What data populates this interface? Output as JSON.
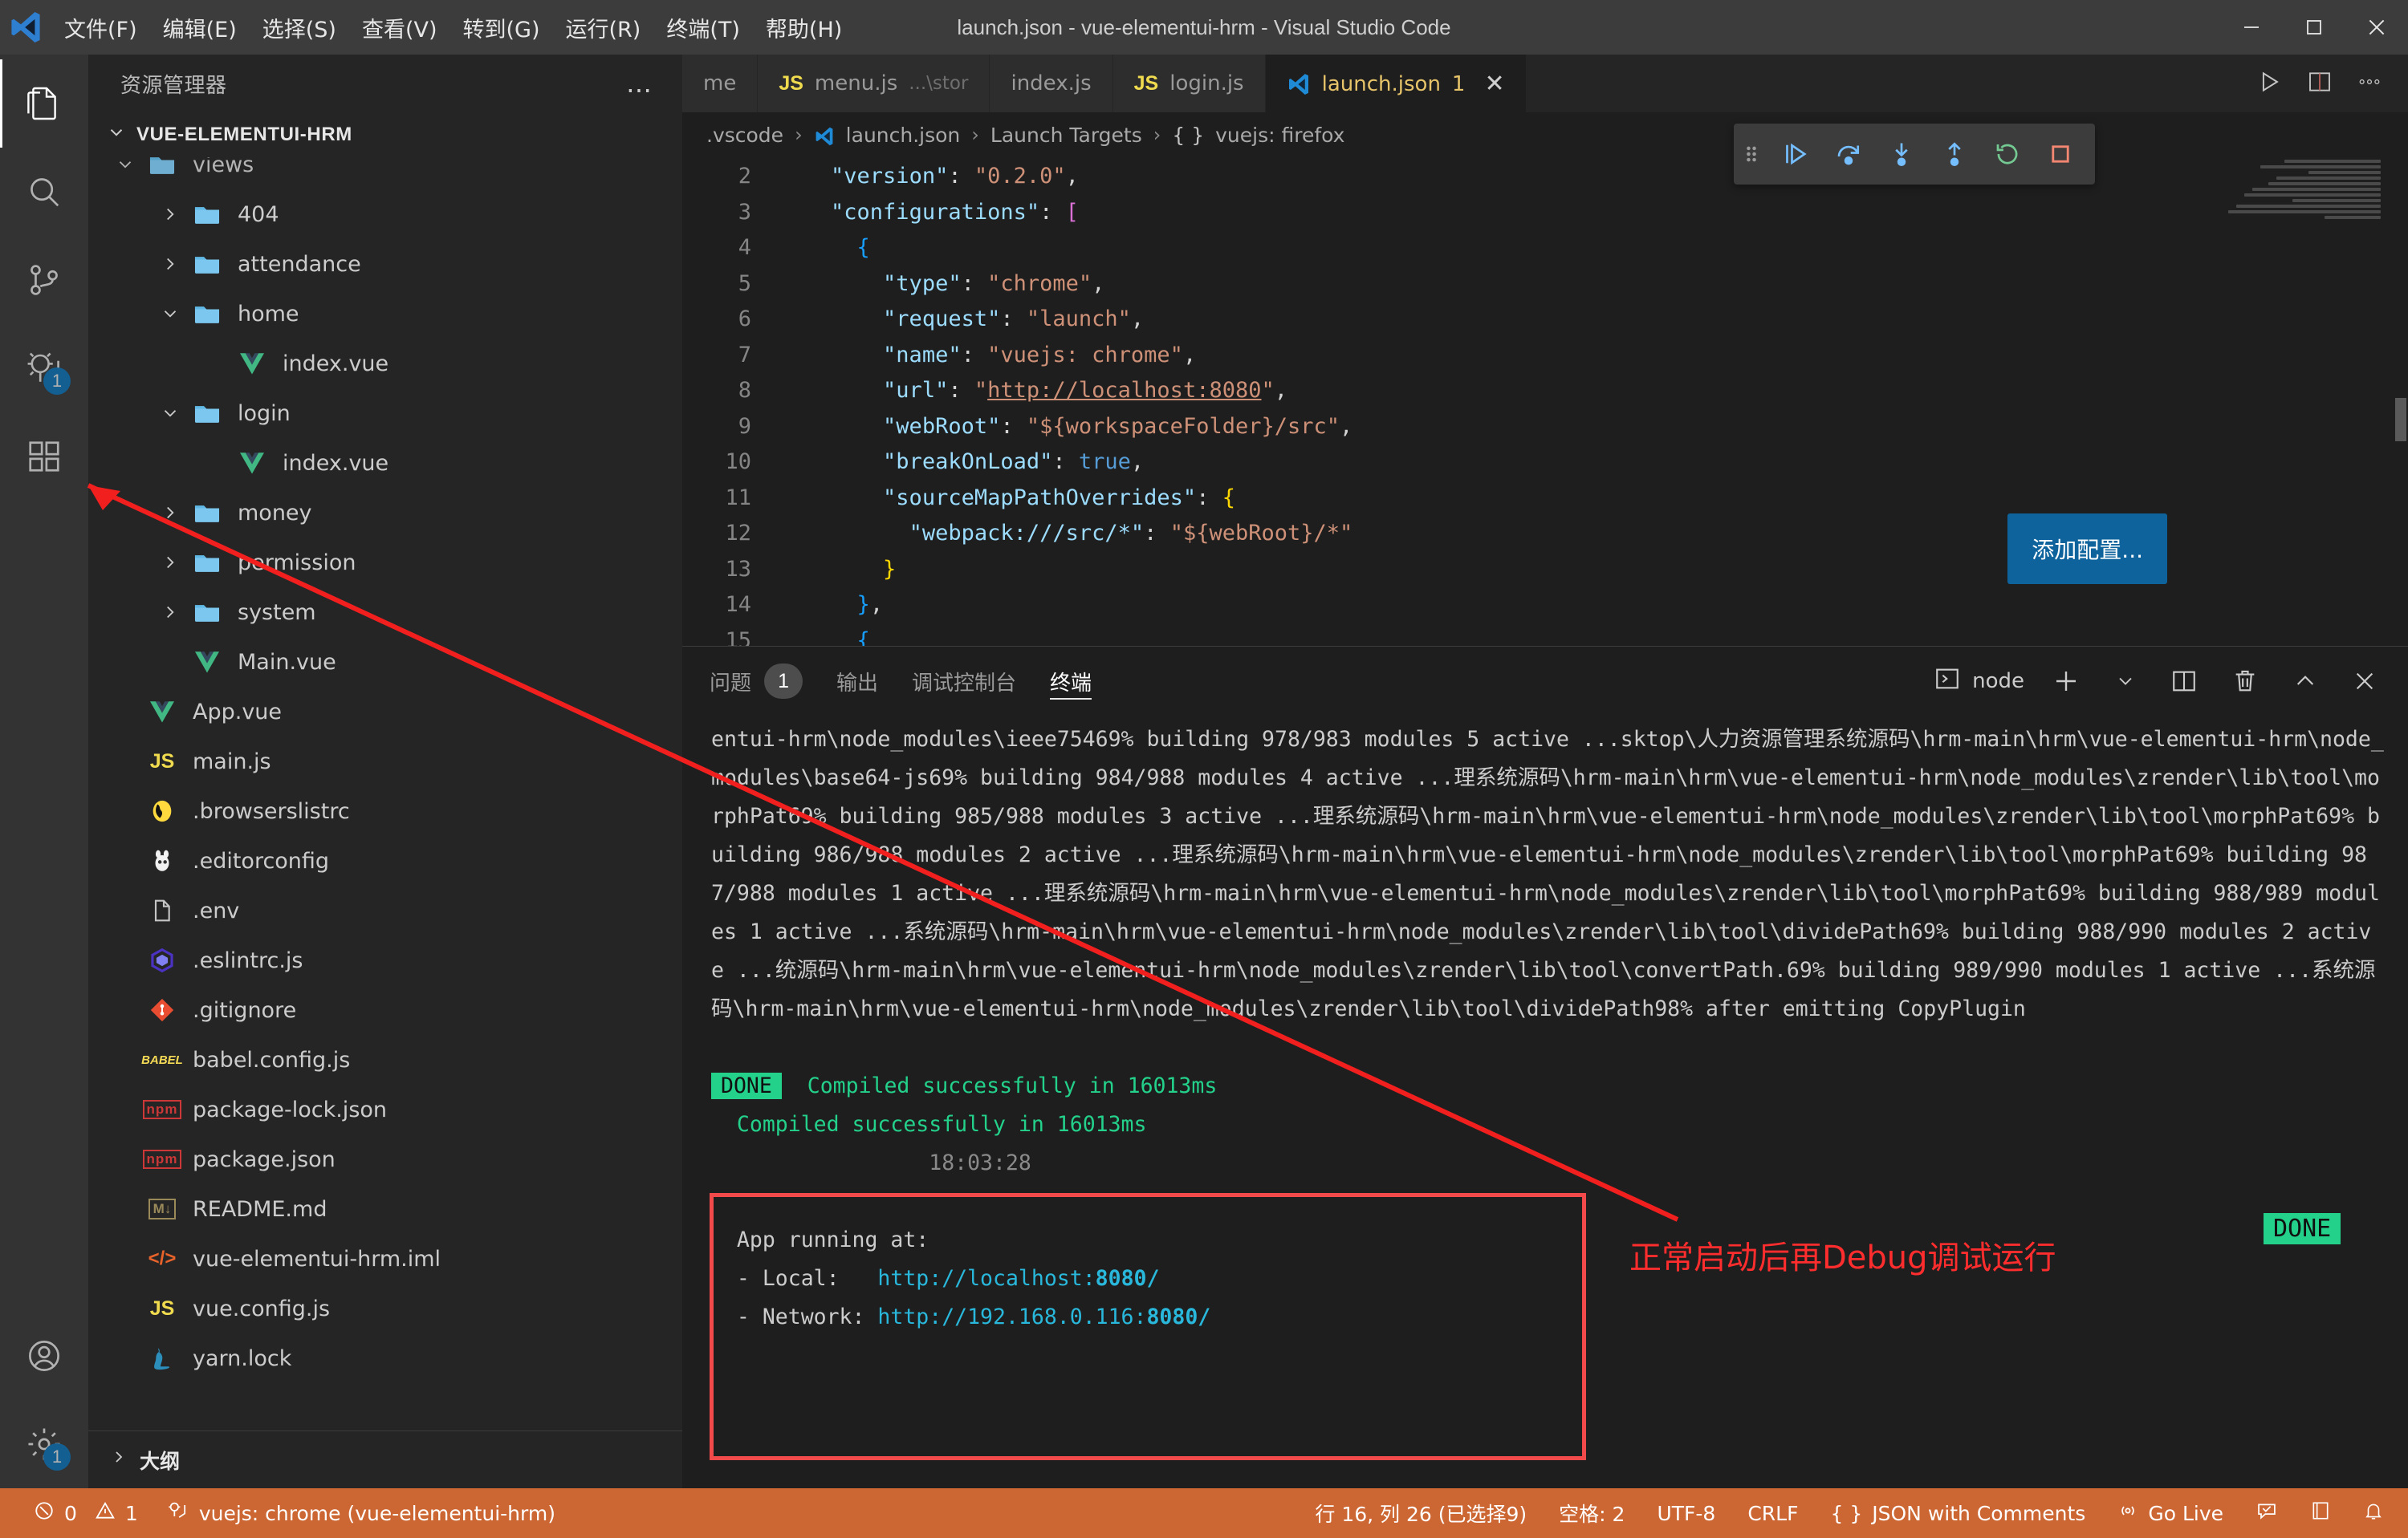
{
  "window": {
    "title": "launch.json - vue-elementui-hrm - Visual Studio Code",
    "menu": [
      "文件(F)",
      "编辑(E)",
      "选择(S)",
      "查看(V)",
      "转到(G)",
      "运行(R)",
      "终端(T)",
      "帮助(H)"
    ],
    "controls": {
      "minimize": "minimize-icon",
      "maximize": "maximize-icon",
      "close": "close-icon"
    }
  },
  "activitybar": {
    "items": [
      {
        "name": "explorer",
        "icon": "files-icon",
        "badge": ""
      },
      {
        "name": "search",
        "icon": "search-icon",
        "badge": ""
      },
      {
        "name": "source-control",
        "icon": "source-control-icon",
        "badge": ""
      },
      {
        "name": "run-and-debug",
        "icon": "debug-icon",
        "badge": "1"
      },
      {
        "name": "extensions",
        "icon": "extensions-icon",
        "badge": ""
      }
    ],
    "bottom": [
      {
        "name": "accounts",
        "icon": "account-icon",
        "badge": ""
      },
      {
        "name": "settings",
        "icon": "gear-icon",
        "badge": "1"
      }
    ]
  },
  "sidebar": {
    "header": "资源管理器",
    "more_actions": "…",
    "root": "VUE-ELEMENTUI-HRM",
    "outline": "大纲",
    "tree": [
      {
        "label": "views",
        "indent": 1,
        "icon": "folder-icon",
        "state": "expanded",
        "cut": true
      },
      {
        "label": "404",
        "indent": 2,
        "icon": "folder-icon",
        "state": "collapsed"
      },
      {
        "label": "attendance",
        "indent": 2,
        "icon": "folder-icon",
        "state": "collapsed"
      },
      {
        "label": "home",
        "indent": 2,
        "icon": "folder-icon",
        "state": "expanded"
      },
      {
        "label": "index.vue",
        "indent": 3,
        "icon": "vue-icon",
        "state": "leaf"
      },
      {
        "label": "login",
        "indent": 2,
        "icon": "folder-icon",
        "state": "expanded"
      },
      {
        "label": "index.vue",
        "indent": 3,
        "icon": "vue-icon",
        "state": "leaf"
      },
      {
        "label": "money",
        "indent": 2,
        "icon": "folder-icon",
        "state": "collapsed"
      },
      {
        "label": "permission",
        "indent": 2,
        "icon": "folder-icon",
        "state": "collapsed"
      },
      {
        "label": "system",
        "indent": 2,
        "icon": "folder-icon",
        "state": "collapsed"
      },
      {
        "label": "Main.vue",
        "indent": 2,
        "icon": "vue-icon",
        "state": "leaf"
      },
      {
        "label": "App.vue",
        "indent": 1,
        "icon": "vue-icon",
        "state": "leaf"
      },
      {
        "label": "main.js",
        "indent": 1,
        "icon": "js-icon",
        "state": "leaf"
      },
      {
        "label": ".browserslistrc",
        "indent": 1,
        "icon": "browserslist-icon",
        "state": "leaf"
      },
      {
        "label": ".editorconfig",
        "indent": 1,
        "icon": "editorconfig-icon",
        "state": "leaf"
      },
      {
        "label": ".env",
        "indent": 1,
        "icon": "file-icon",
        "state": "leaf"
      },
      {
        "label": ".eslintrc.js",
        "indent": 1,
        "icon": "eslint-icon",
        "state": "leaf"
      },
      {
        "label": ".gitignore",
        "indent": 1,
        "icon": "git-icon",
        "state": "leaf"
      },
      {
        "label": "babel.config.js",
        "indent": 1,
        "icon": "babel-icon",
        "state": "leaf"
      },
      {
        "label": "package-lock.json",
        "indent": 1,
        "icon": "npm-icon",
        "state": "leaf"
      },
      {
        "label": "package.json",
        "indent": 1,
        "icon": "npm-icon",
        "state": "leaf"
      },
      {
        "label": "README.md",
        "indent": 1,
        "icon": "markdown-icon",
        "state": "leaf"
      },
      {
        "label": "vue-elementui-hrm.iml",
        "indent": 1,
        "icon": "xml-icon",
        "state": "leaf"
      },
      {
        "label": "vue.config.js",
        "indent": 1,
        "icon": "js-icon",
        "state": "leaf"
      },
      {
        "label": "yarn.lock",
        "indent": 1,
        "icon": "yarn-icon",
        "state": "leaf"
      }
    ]
  },
  "editor": {
    "tabs": [
      {
        "label": "me",
        "detail": "",
        "icon": "",
        "active": false,
        "dirty": ""
      },
      {
        "label": "menu.js",
        "detail": "...\\stor",
        "icon": "js-icon",
        "active": false,
        "dirty": ""
      },
      {
        "label": "index.js",
        "detail": "",
        "icon": "",
        "active": false,
        "dirty": ""
      },
      {
        "label": "login.js",
        "detail": "",
        "icon": "js-icon",
        "active": false,
        "dirty": ""
      },
      {
        "label": "launch.json",
        "detail": "1",
        "icon": "vscode-icon",
        "active": true,
        "dirty": ""
      }
    ],
    "tab_close": "✕",
    "actions": [
      "run-icon",
      "split-editor-icon",
      "more-actions-icon"
    ],
    "breadcrumb": [
      ".vscode",
      "launch.json",
      "Launch Targets",
      "vuejs: firefox"
    ],
    "breadcrumb_icons": [
      "",
      "vscode-icon",
      "",
      "braces-icon"
    ],
    "add_config_button": "添加配置...",
    "lines": [
      {
        "n": "2",
        "tokens": [
          {
            "t": "    ",
            "c": "k-punc"
          },
          {
            "t": "\"version\"",
            "c": "k-key"
          },
          {
            "t": ": ",
            "c": "k-punc"
          },
          {
            "t": "\"0.2.0\"",
            "c": "k-str"
          },
          {
            "t": ",",
            "c": "k-punc"
          }
        ]
      },
      {
        "n": "3",
        "tokens": [
          {
            "t": "    ",
            "c": "k-punc"
          },
          {
            "t": "\"configurations\"",
            "c": "k-key"
          },
          {
            "t": ": ",
            "c": "k-punc"
          },
          {
            "t": "[",
            "c": "k-brk1"
          }
        ]
      },
      {
        "n": "4",
        "tokens": [
          {
            "t": "      ",
            "c": "k-punc"
          },
          {
            "t": "{",
            "c": "k-brk3"
          }
        ]
      },
      {
        "n": "5",
        "tokens": [
          {
            "t": "        ",
            "c": "k-punc"
          },
          {
            "t": "\"type\"",
            "c": "k-key"
          },
          {
            "t": ": ",
            "c": "k-punc"
          },
          {
            "t": "\"chrome\"",
            "c": "k-str"
          },
          {
            "t": ",",
            "c": "k-punc"
          }
        ]
      },
      {
        "n": "6",
        "tokens": [
          {
            "t": "        ",
            "c": "k-punc"
          },
          {
            "t": "\"request\"",
            "c": "k-key"
          },
          {
            "t": ": ",
            "c": "k-punc"
          },
          {
            "t": "\"launch\"",
            "c": "k-str"
          },
          {
            "t": ",",
            "c": "k-punc"
          }
        ]
      },
      {
        "n": "7",
        "tokens": [
          {
            "t": "        ",
            "c": "k-punc"
          },
          {
            "t": "\"name\"",
            "c": "k-key"
          },
          {
            "t": ": ",
            "c": "k-punc"
          },
          {
            "t": "\"vuejs: chrome\"",
            "c": "k-str"
          },
          {
            "t": ",",
            "c": "k-punc"
          }
        ]
      },
      {
        "n": "8",
        "tokens": [
          {
            "t": "        ",
            "c": "k-punc"
          },
          {
            "t": "\"url\"",
            "c": "k-key"
          },
          {
            "t": ": ",
            "c": "k-punc"
          },
          {
            "t": "\"",
            "c": "k-str"
          },
          {
            "t": "http://localhost:8080",
            "c": "k-url"
          },
          {
            "t": "\"",
            "c": "k-str"
          },
          {
            "t": ",",
            "c": "k-punc"
          }
        ]
      },
      {
        "n": "9",
        "tokens": [
          {
            "t": "        ",
            "c": "k-punc"
          },
          {
            "t": "\"webRoot\"",
            "c": "k-key"
          },
          {
            "t": ": ",
            "c": "k-punc"
          },
          {
            "t": "\"${workspaceFolder}/src\"",
            "c": "k-str"
          },
          {
            "t": ",",
            "c": "k-punc"
          }
        ]
      },
      {
        "n": "10",
        "tokens": [
          {
            "t": "        ",
            "c": "k-punc"
          },
          {
            "t": "\"breakOnLoad\"",
            "c": "k-key"
          },
          {
            "t": ": ",
            "c": "k-punc"
          },
          {
            "t": "true",
            "c": "k-bool"
          },
          {
            "t": ",",
            "c": "k-punc"
          }
        ]
      },
      {
        "n": "11",
        "tokens": [
          {
            "t": "        ",
            "c": "k-punc"
          },
          {
            "t": "\"sourceMapPathOverrides\"",
            "c": "k-key"
          },
          {
            "t": ": ",
            "c": "k-punc"
          },
          {
            "t": "{",
            "c": "k-brk2"
          }
        ]
      },
      {
        "n": "12",
        "tokens": [
          {
            "t": "          ",
            "c": "k-punc"
          },
          {
            "t": "\"webpack:///src/*\"",
            "c": "k-key"
          },
          {
            "t": ": ",
            "c": "k-punc"
          },
          {
            "t": "\"${webRoot}/*\"",
            "c": "k-str"
          }
        ]
      },
      {
        "n": "13",
        "tokens": [
          {
            "t": "        ",
            "c": "k-punc"
          },
          {
            "t": "}",
            "c": "k-brk2"
          }
        ]
      },
      {
        "n": "14",
        "tokens": [
          {
            "t": "      ",
            "c": "k-punc"
          },
          {
            "t": "}",
            "c": "k-brk3"
          },
          {
            "t": ",",
            "c": "k-punc"
          }
        ]
      },
      {
        "n": "15",
        "tokens": [
          {
            "t": "      ",
            "c": "k-punc"
          },
          {
            "t": "{",
            "c": "k-brk3"
          }
        ]
      }
    ]
  },
  "debug_toolbar": {
    "buttons": [
      "grip-icon",
      "continue-icon",
      "step-over-icon",
      "step-into-icon",
      "step-out-icon",
      "restart-icon",
      "stop-icon"
    ]
  },
  "panel": {
    "tabs": [
      {
        "label": "问题",
        "badge": "1",
        "active": false
      },
      {
        "label": "输出",
        "badge": "",
        "active": false
      },
      {
        "label": "调试控制台",
        "badge": "",
        "active": false
      },
      {
        "label": "终端",
        "badge": "",
        "active": true
      }
    ],
    "terminal_name": "node",
    "actions": [
      "new-terminal-icon",
      "terminal-dropdown-icon",
      "split-terminal-icon",
      "kill-terminal-icon",
      "maximize-panel-icon",
      "close-panel-icon"
    ]
  },
  "terminal": {
    "log": "entui-hrm\\node_modules\\ieee75469% building 978/983 modules 5 active ...sktop\\人力资源管理系统源码\\hrm-main\\hrm\\vue-elementui-hrm\\node_modules\\base64-js69% building 984/988 modules 4 active ...理系统源码\\hrm-main\\hrm\\vue-elementui-hrm\\node_modules\\zrender\\lib\\tool\\morphPat69% building 985/988 modules 3 active ...理系统源码\\hrm-main\\hrm\\vue-elementui-hrm\\node_modules\\zrender\\lib\\tool\\morphPat69% building 986/988 modules 2 active ...理系统源码\\hrm-main\\hrm\\vue-elementui-hrm\\node_modules\\zrender\\lib\\tool\\morphPat69% building 987/988 modules 1 active ...理系统源码\\hrm-main\\hrm\\vue-elementui-hrm\\node_modules\\zrender\\lib\\tool\\morphPat69% building 988/989 modules 1 active ...系统源码\\hrm-main\\hrm\\vue-elementui-hrm\\node_modules\\zrender\\lib\\tool\\dividePath69% building 988/990 modules 2 active ...统源码\\hrm-main\\hrm\\vue-elementui-hrm\\node_modules\\zrender\\lib\\tool\\convertPath.69% building 989/990 modules 1 active ...系统源码\\hrm-main\\hrm\\vue-elementui-hrm\\node_modules\\zrender\\lib\\tool\\dividePath98% after emitting CopyPlugin",
    "done_chip": "DONE",
    "compiled_line1": "Compiled successfully in 16013ms",
    "compiled_line2": "  Compiled successfully in 16013ms",
    "timestamp": "18:03:28",
    "app_running": "  App running at:",
    "local_label": "  - Local:   ",
    "local_url": "http://localhost:",
    "local_port": "8080/",
    "network_label": "  - Network: ",
    "network_url": "http://192.168.0.116:",
    "network_port": "8080/"
  },
  "annotation": {
    "text": "正常启动后再Debug调试运行",
    "color": "#ff2d2d",
    "done_chip": "DONE"
  },
  "statusbar": {
    "errors": "0",
    "warnings": "1",
    "debug_target": "vuejs: chrome (vue-elementui-hrm)",
    "cursor": "行 16, 列 26 (已选择9)",
    "spaces": "空格: 2",
    "encoding": "UTF-8",
    "eol": "CRLF",
    "language": "JSON with Comments",
    "golive": "Go Live",
    "icons": [
      "error-icon",
      "warning-icon",
      "debug-target-icon",
      "braces-icon",
      "broadcast-icon",
      "feedback-icon",
      "notebook-icon",
      "bell-icon"
    ],
    "background": "#cc6633"
  }
}
